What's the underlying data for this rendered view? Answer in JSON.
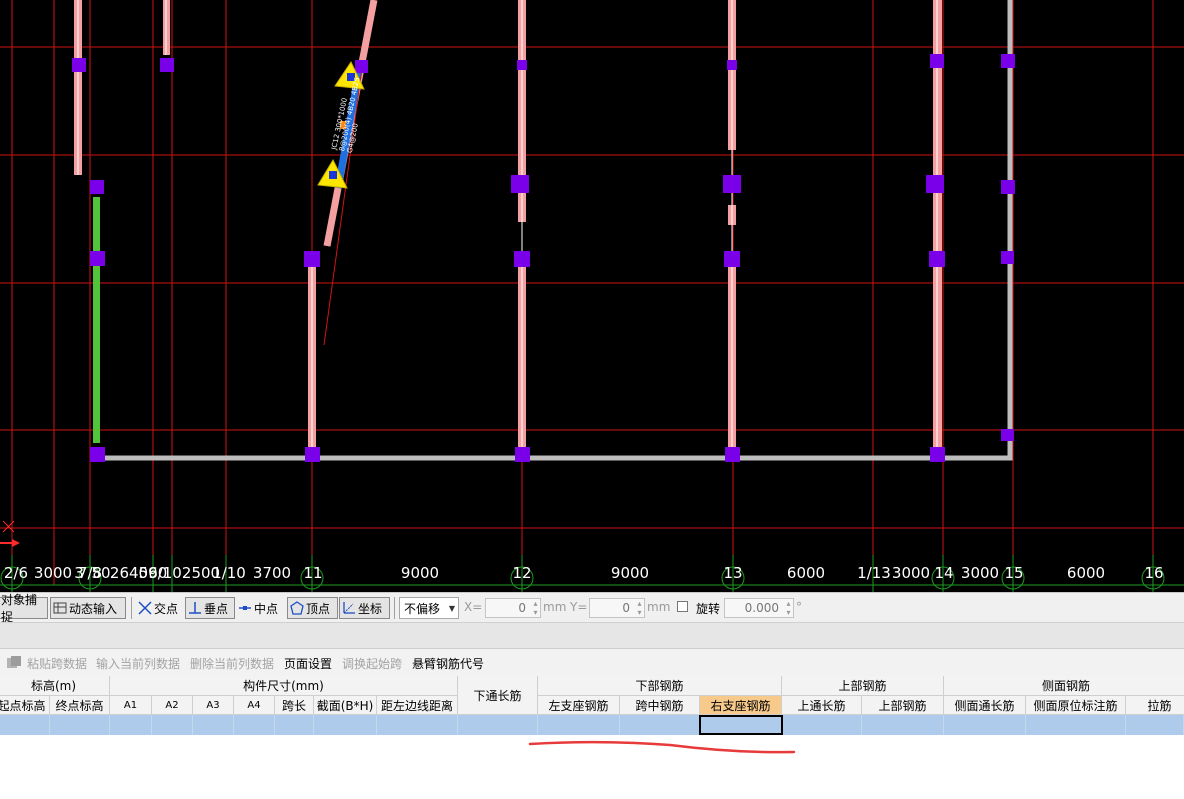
{
  "drawing": {
    "axis_labels": [
      {
        "text": "2/6"
      },
      {
        "text": "3000"
      },
      {
        "text": "3"
      },
      {
        "text": "7/8"
      },
      {
        "text": "50"
      },
      {
        "text": "2640"
      },
      {
        "text": "560"
      },
      {
        "text": "9/10"
      },
      {
        "text": "2500"
      },
      {
        "text": "1/10"
      },
      {
        "text": "3700"
      },
      {
        "text": "11"
      },
      {
        "text": "9000"
      },
      {
        "text": "12"
      },
      {
        "text": "9000"
      },
      {
        "text": "13"
      },
      {
        "text": "6000"
      },
      {
        "text": "1/13"
      },
      {
        "text": "3000"
      },
      {
        "text": "14"
      },
      {
        "text": "3000"
      },
      {
        "text": "15"
      },
      {
        "text": "6000"
      },
      {
        "text": "16"
      }
    ],
    "beam_annotation_lines": [
      "JC12 300*1000",
      "8@200(4)  4B20 4B25",
      "G4@200"
    ]
  },
  "snapbar": {
    "object_snap": "对象捕捉",
    "dynamic_input": "动态输入",
    "intersection": "交点",
    "perpendicular": "垂点",
    "midpoint": "中点",
    "vertex": "顶点",
    "coordinate": "坐标",
    "offset_mode": "不偏移",
    "x_label": "X=",
    "x_value": "0",
    "x_unit": "mm",
    "y_label": "Y=",
    "y_value": "0",
    "y_unit": "mm",
    "rotate_label": "旋转",
    "rotate_value": "0.000",
    "degree": "°"
  },
  "table_toolbar": {
    "paste": "粘贴跨数据",
    "insert_col": "输入当前列数据",
    "delete_col": "删除当前列数据",
    "page_setup": "页面设置",
    "adjust_start": "调换起始跨",
    "cantilever_code": "悬臂钢筋代号"
  },
  "table": {
    "groups": {
      "elevation": "标高(m)",
      "size": "构件尺寸(mm)",
      "bottom_through": "下通长筋",
      "bottom_rebar": "下部钢筋",
      "top_rebar": "上部钢筋",
      "side_rebar": "侧面钢筋"
    },
    "columns": {
      "start_elev": "起点标高",
      "end_elev": "终点标高",
      "a1": "A1",
      "a2": "A2",
      "a3": "A3",
      "a4": "A4",
      "span": "跨长",
      "section": "截面(B*H)",
      "left_dist": "距左边线距离",
      "left_support": "左支座钢筋",
      "mid_span": "跨中钢筋",
      "right_support": "右支座钢筋",
      "top_through": "上通长筋",
      "top_bars": "上部钢筋",
      "side_through": "侧面通长筋",
      "side_original": "侧面原位标注筋",
      "tie": "拉筋"
    }
  }
}
